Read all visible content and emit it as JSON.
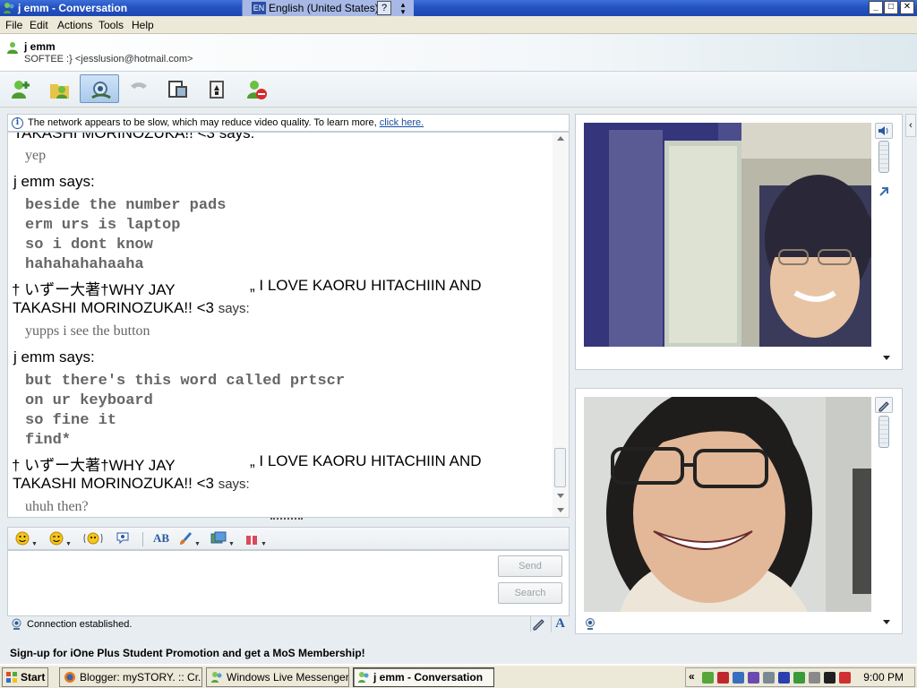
{
  "window": {
    "title": "j emm - Conversation",
    "controls": [
      "_",
      "□",
      "✕"
    ]
  },
  "langbar": {
    "code": "EN",
    "language": "English (United States)",
    "help": "?"
  },
  "menu": [
    "File",
    "Edit",
    "Actions",
    "Tools",
    "Help"
  ],
  "contact": {
    "name": "j emm",
    "status": "SOFTEE :} <jesslusion@hotmail.com>"
  },
  "toolbar": [
    "invite-contact-icon",
    "send-files-icon",
    "video-call-icon",
    "voice-call-icon",
    "activities-icon",
    "games-icon",
    "block-icon"
  ],
  "notice": {
    "text": "The network appears to be slow, which may reduce video quality. To learn more,",
    "link": "click here."
  },
  "conversation": {
    "partial_top": "TAKASHI MORINOZUKA!! <3 says:",
    "msg1": "yep",
    "sender1": "j emm says:",
    "msg2": [
      "beside the number pads",
      "erm urs is laptop",
      "so i dont know",
      "hahahahahaaha"
    ],
    "sender2_line1": "† いずー大著†WHY JAY",
    "sender2_line1b": "„ I LOVE KAORU HITACHIIN AND",
    "sender2_line2": "TAKASHI MORINOZUKA!! <3",
    "says_word": "says:",
    "msg3": "yupps i see the button",
    "sender3": "j emm says:",
    "msg4": [
      "but there's this word called prtscr",
      "on ur keyboard",
      "so fine it",
      "find*"
    ],
    "msg5": "uhuh then?"
  },
  "compose": {
    "send": "Send",
    "search": "Search"
  },
  "status": {
    "text": "Connection established."
  },
  "promo": "Sign-up for iOne Plus Student Promotion and get a MoS Membership!",
  "taskbar": {
    "start": "Start",
    "tasks": [
      "Blogger: mySTORY. :: Cr...",
      "Windows Live Messenger",
      "j emm - Conversation"
    ],
    "clock": "9:00 PM"
  },
  "colors": {
    "titlebar": "#2453c0",
    "link": "#1a4fa0",
    "message_text": "#666666"
  }
}
